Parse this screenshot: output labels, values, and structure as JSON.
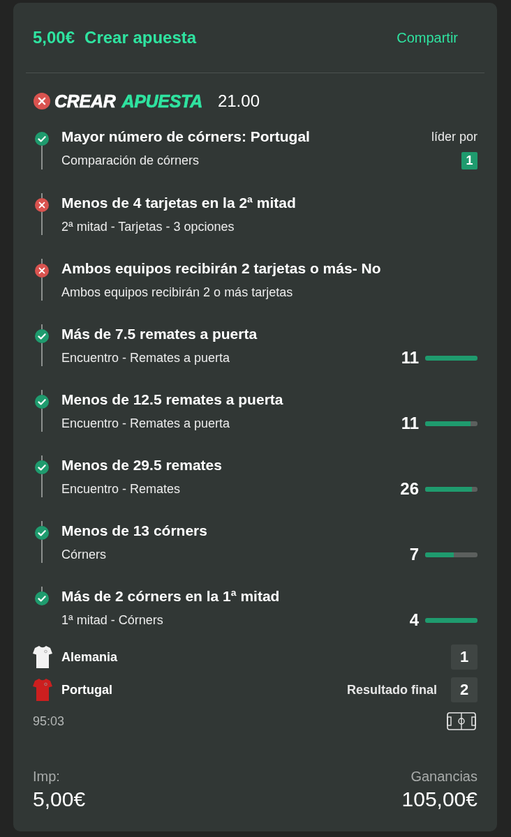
{
  "header": {
    "stake": "5,00€",
    "title": "Crear apuesta",
    "share": "Compartir"
  },
  "bet": {
    "won": false,
    "brand_first": "CREAR",
    "brand_second": "APUESTA",
    "odds": "21.00"
  },
  "selections": [
    {
      "kind": "lead",
      "won": true,
      "title": "Mayor número de córners: Portugal",
      "subtitle": "Comparación de córners",
      "lead_label": "líder por",
      "lead_value": "1"
    },
    {
      "kind": "plain",
      "won": false,
      "title": "Menos de 4 tarjetas en la 2ª mitad",
      "subtitle": "2ª mitad - Tarjetas - 3 opciones"
    },
    {
      "kind": "plain",
      "won": false,
      "title": "Ambos equipos recibirán 2 tarjetas o más- No",
      "subtitle": "Ambos equipos recibirán 2 o más tarjetas"
    },
    {
      "kind": "progress",
      "won": true,
      "title": "Más de 7.5 remates a puerta",
      "subtitle": "Encuentro - Remates a puerta",
      "value": "11",
      "level": 1
    },
    {
      "kind": "progress",
      "won": true,
      "title": "Menos de 12.5 remates a puerta",
      "subtitle": "Encuentro - Remates a puerta",
      "value": "11",
      "level": 0.87
    },
    {
      "kind": "progress",
      "won": true,
      "title": "Menos de 29.5 remates",
      "subtitle": "Encuentro - Remates",
      "value": "26",
      "level": 0.89
    },
    {
      "kind": "progress",
      "won": true,
      "title": "Menos de 13 córners",
      "subtitle": "Córners",
      "value": "7",
      "level": 0.54
    },
    {
      "kind": "progress",
      "won": true,
      "title": "Más de 2 córners en la 1ª mitad",
      "subtitle": "1ª mitad - Córners",
      "value": "4",
      "level": 1
    }
  ],
  "match": {
    "teams": [
      {
        "name": "Alemania",
        "color": "#f2f2f2",
        "score": "1"
      },
      {
        "name": "Portugal",
        "color": "#cc1f1f",
        "score": "2"
      }
    ],
    "result_label": "Resultado final",
    "clock": "95:03"
  },
  "footer": {
    "stake_label": "Imp:",
    "stake": "5,00€",
    "win_label": "Ganancias",
    "win": "105,00€"
  }
}
